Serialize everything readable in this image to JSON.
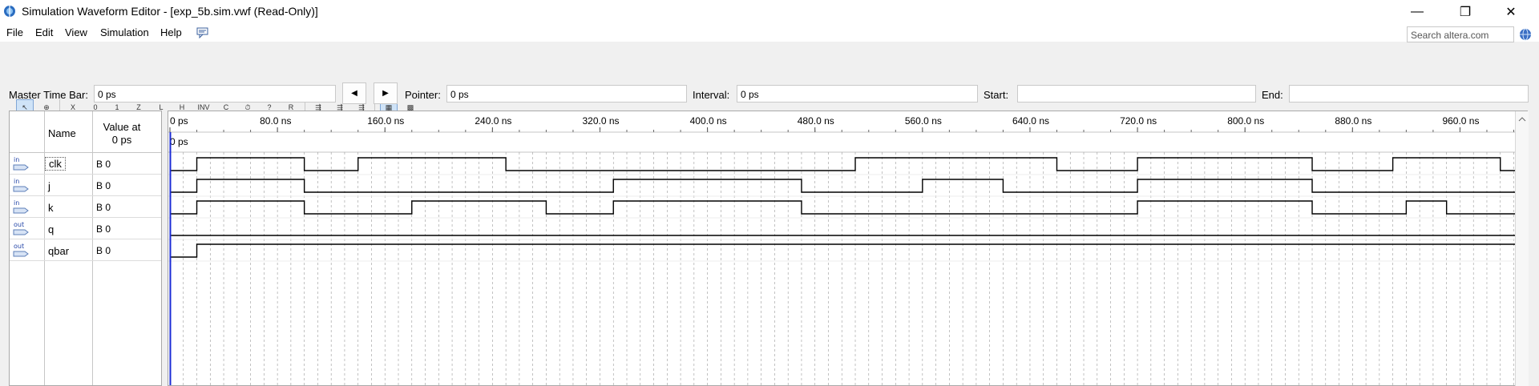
{
  "window": {
    "title": "Simulation Waveform Editor - [exp_5b.sim.vwf (Read-Only)]",
    "minimize_glyph": "—",
    "restore_glyph": "❐",
    "close_glyph": "✕"
  },
  "menubar": {
    "items": [
      "File",
      "Edit",
      "View",
      "Simulation",
      "Help"
    ],
    "search_placeholder": "Search altera.com"
  },
  "toolbar": {
    "buttons": [
      {
        "icon": "selection-tool-icon",
        "glyph": "↖",
        "active": true
      },
      {
        "icon": "zoom-tool-icon",
        "glyph": "⊕",
        "active": false
      },
      {
        "icon": "force-unknown-icon",
        "glyph": "X",
        "active": false
      },
      {
        "icon": "force-low-icon",
        "glyph": "0",
        "active": false
      },
      {
        "icon": "force-high-icon",
        "glyph": "1",
        "active": false
      },
      {
        "icon": "force-high-impedance-icon",
        "glyph": "Z",
        "active": false
      },
      {
        "icon": "force-weak-low-icon",
        "glyph": "L",
        "active": false
      },
      {
        "icon": "force-weak-high-icon",
        "glyph": "H",
        "active": false
      },
      {
        "icon": "invert-icon",
        "glyph": "INV",
        "active": false
      },
      {
        "icon": "count-value-icon",
        "glyph": "C",
        "active": false
      },
      {
        "icon": "overwrite-clock-icon",
        "glyph": "⏱",
        "active": false
      },
      {
        "icon": "random-values-icon",
        "glyph": "?",
        "active": false
      },
      {
        "icon": "arbitrary-value-icon",
        "glyph": "R",
        "active": false
      },
      {
        "icon": "functional-simulation-icon",
        "glyph": "⇶",
        "active": false
      },
      {
        "icon": "timing-simulation-icon",
        "glyph": "⇶",
        "active": false
      },
      {
        "icon": "netlist-generation-icon",
        "glyph": "⇶",
        "active": false
      },
      {
        "icon": "snap-to-grid-icon",
        "glyph": "▦",
        "active": true
      },
      {
        "icon": "grouping-icon",
        "glyph": "▩",
        "active": false
      }
    ]
  },
  "controls": {
    "master_label": "Master Time Bar:",
    "master_value": "0 ps",
    "prev_glyph": "◀",
    "next_glyph": "▶",
    "pointer_label": "Pointer:",
    "pointer_value": "0 ps",
    "interval_label": "Interval:",
    "interval_value": "0 ps",
    "start_label": "Start:",
    "start_value": "",
    "end_label": "End:",
    "end_value": ""
  },
  "signal_table": {
    "name_header": "Name",
    "value_header_line1": "Value at",
    "value_header_line2": "0 ps",
    "signals": [
      {
        "name": "clk",
        "direction": "in",
        "value": "B 0",
        "icon": "input-pin-icon"
      },
      {
        "name": "j",
        "direction": "in",
        "value": "B 0",
        "icon": "input-pin-icon"
      },
      {
        "name": "k",
        "direction": "in",
        "value": "B 0",
        "icon": "input-pin-icon"
      },
      {
        "name": "q",
        "direction": "out",
        "value": "B 0",
        "icon": "output-pin-icon"
      },
      {
        "name": "qbar",
        "direction": "out",
        "value": "B 0",
        "icon": "output-pin-icon"
      }
    ]
  },
  "timeline": {
    "ticks": [
      "0 ps",
      "80.0 ns",
      "160.0 ns",
      "240.0 ns",
      "320.0 ns",
      "400.0 ns",
      "480.0 ns",
      "560.0 ns",
      "640.0 ns",
      "720.0 ns",
      "800.0 ns",
      "880.0 ns",
      "960.0 ns"
    ],
    "tick_values_ns": [
      0,
      80,
      160,
      240,
      320,
      400,
      480,
      560,
      640,
      720,
      800,
      880,
      960
    ],
    "cursor_label": "0 ps",
    "cursor_ns": 0,
    "visible_range_ns": [
      0,
      1000
    ]
  },
  "waveforms": {
    "clk": [
      [
        0,
        0
      ],
      [
        20,
        1
      ],
      [
        100,
        0
      ],
      [
        140,
        1
      ],
      [
        250,
        0
      ],
      [
        510,
        1
      ],
      [
        660,
        0
      ],
      [
        720,
        1
      ],
      [
        850,
        0
      ],
      [
        910,
        1
      ],
      [
        990,
        0
      ]
    ],
    "j": [
      [
        0,
        0
      ],
      [
        20,
        1
      ],
      [
        100,
        0
      ],
      [
        330,
        1
      ],
      [
        470,
        0
      ],
      [
        560,
        1
      ],
      [
        620,
        0
      ],
      [
        720,
        1
      ],
      [
        850,
        0
      ]
    ],
    "k": [
      [
        0,
        0
      ],
      [
        20,
        1
      ],
      [
        100,
        0
      ],
      [
        180,
        1
      ],
      [
        280,
        0
      ],
      [
        330,
        1
      ],
      [
        470,
        0
      ],
      [
        720,
        1
      ],
      [
        850,
        0
      ],
      [
        920,
        1
      ],
      [
        950,
        0
      ]
    ],
    "q": [
      [
        0,
        0
      ]
    ],
    "qbar": [
      [
        0,
        0
      ],
      [
        20,
        1
      ]
    ]
  },
  "colors": {
    "cursor": "#1a2bd6",
    "wave": "#000000",
    "grid": "#9a9a9a",
    "active_button": "#cfe3f7"
  }
}
